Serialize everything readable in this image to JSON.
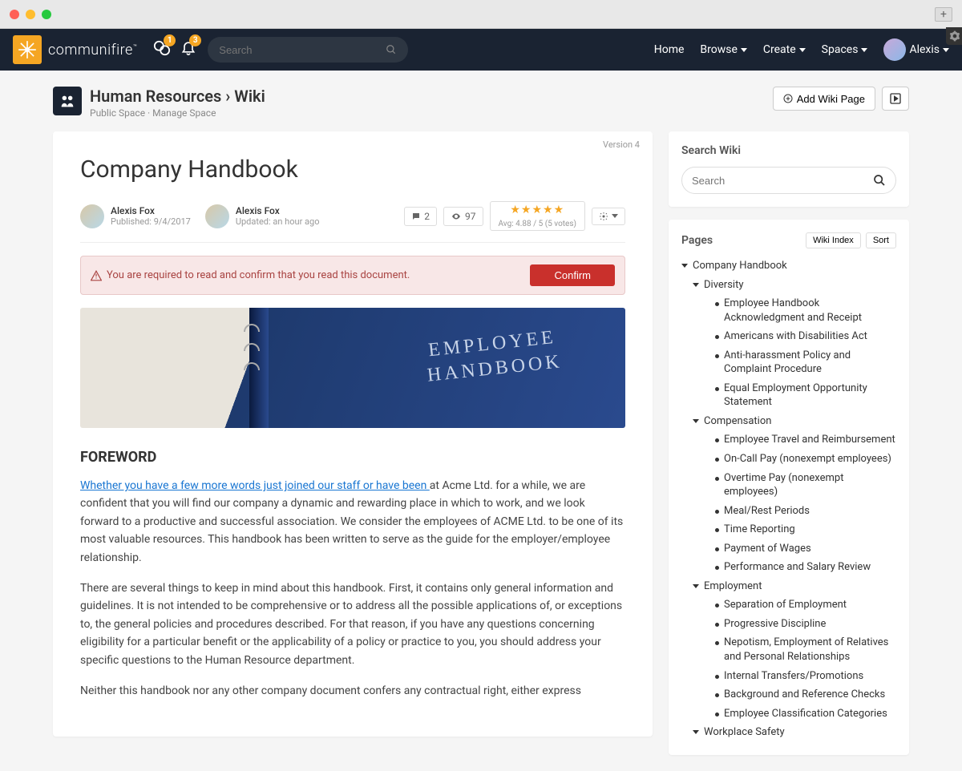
{
  "nav": {
    "brand": "communifire",
    "search_placeholder": "Search",
    "chat_badge": "1",
    "bell_badge": "3",
    "menu": [
      "Home",
      "Browse",
      "Create",
      "Spaces"
    ],
    "user": "Alexis"
  },
  "header": {
    "space": "Human Resources",
    "section": "Wiki",
    "sub_public": "Public Space",
    "sub_manage": "Manage Space",
    "add_button": "Add Wiki Page"
  },
  "page": {
    "version": "Version 4",
    "title": "Company Handbook",
    "author1_name": "Alexis Fox",
    "author1_sub": "Published: 9/4/2017",
    "author2_name": "Alexis Fox",
    "author2_sub": "Updated: an hour ago",
    "comments": "2",
    "views": "97",
    "rating_text": "Avg: 4.88 / 5 (5 votes)",
    "alert_text": "You are required to read and confirm that you read this document.",
    "confirm_button": "Confirm",
    "hero_line1": "EMPLOYEE",
    "hero_line2": "HANDBOOK",
    "foreword_heading": "FOREWORD",
    "link_text": "Whether you have a few more words just joined our staff or have been ",
    "p1_rest": "at Acme Ltd. for a while, we are confident that you will find our company a dynamic and rewarding place in which to work, and we look forward to a productive and successful association. We consider the employees of ACME Ltd. to be one of its most valuable resources. This handbook has been written to serve as the guide for the employer/employee relationship.",
    "p2": "There are several things to keep in mind about this handbook. First, it contains only general information and guidelines. It is not intended to be comprehensive or to address all the possible applications of, or exceptions to, the general policies and procedures described. For that reason, if you have any questions concerning eligibility for a particular benefit or the applicability of a policy or practice to you, you should address your specific questions to the Human Resource department.",
    "p3": "Neither this handbook nor any other company document confers any contractual right, either express"
  },
  "sidebar": {
    "search_title": "Search Wiki",
    "search_placeholder": "Search",
    "pages_title": "Pages",
    "wiki_index": "Wiki Index",
    "sort": "Sort"
  },
  "tree": {
    "root": "Company Handbook",
    "sections": [
      {
        "label": "Diversity",
        "items": [
          "Employee Handbook Acknowledgment and Receipt",
          "Americans with Disabilities Act",
          "Anti-harassment Policy and Complaint Procedure",
          "Equal Employment Opportunity Statement"
        ]
      },
      {
        "label": "Compensation",
        "items": [
          "Employee Travel and Reimbursement",
          "On-Call Pay (nonexempt employees)",
          "Overtime Pay (nonexempt employees)",
          "Meal/Rest Periods",
          "Time Reporting",
          "Payment of Wages",
          "Performance and Salary Review"
        ]
      },
      {
        "label": "Employment",
        "items": [
          "Separation of Employment",
          "Progressive Discipline",
          "Nepotism, Employment of Relatives and Personal Relationships",
          "Internal Transfers/Promotions",
          "Background and Reference Checks",
          "Employee Classification Categories"
        ]
      },
      {
        "label": "Workplace Safety",
        "items": []
      }
    ]
  }
}
